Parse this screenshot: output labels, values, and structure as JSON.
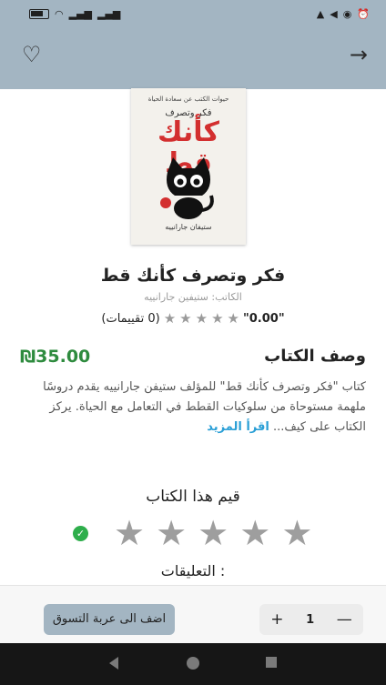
{
  "status_bar": {
    "left_icons": [
      "battery-icon",
      "wifi-icon",
      "signal-icon",
      "signal-icon"
    ],
    "right_icons": [
      "notification-icon",
      "location-icon",
      "whatsapp-icon",
      "alarm-icon"
    ]
  },
  "app_bar": {
    "favorite_icon": "heart-icon",
    "back_icon": "arrow-right-icon"
  },
  "book": {
    "cover": {
      "tagline": "حيوات الكتب عن سعادة الحياة",
      "small_title": "فكر وتصرف",
      "big_title": "كأنك قط",
      "author_line": "ستيفان جارانييه"
    },
    "title": "فكر وتصرف كأنك قط",
    "author": "الكاتب: ستيفين جارانييه",
    "rating_score": "\"0.00\"",
    "rating_count": "(0 تقييمات)",
    "price": "₪35.00"
  },
  "description": {
    "heading": "وصف الكتاب",
    "text": "كتاب \"فكر وتصرف كأنك قط\" للمؤلف ستيفن جارانييه يقدم دروسًا ملهمة مستوحاة من سلوكيات القطط في التعامل مع الحياة. يركز الكتاب على كيف...",
    "read_more": "اقرأ المزيد"
  },
  "rate_section": {
    "title": "قيم هذا الكتاب",
    "stars": 5,
    "confirm_icon": "check-circle-icon"
  },
  "comments": {
    "title": ": التعليقات"
  },
  "cart": {
    "add_label": "اضف الى عربة التسوق",
    "quantity": "1",
    "plus": "+",
    "minus": "—"
  },
  "colors": {
    "accent": "#a3b5c2",
    "price": "#2e8b3e",
    "link": "#2a9fd6",
    "check": "#2eae4b"
  }
}
